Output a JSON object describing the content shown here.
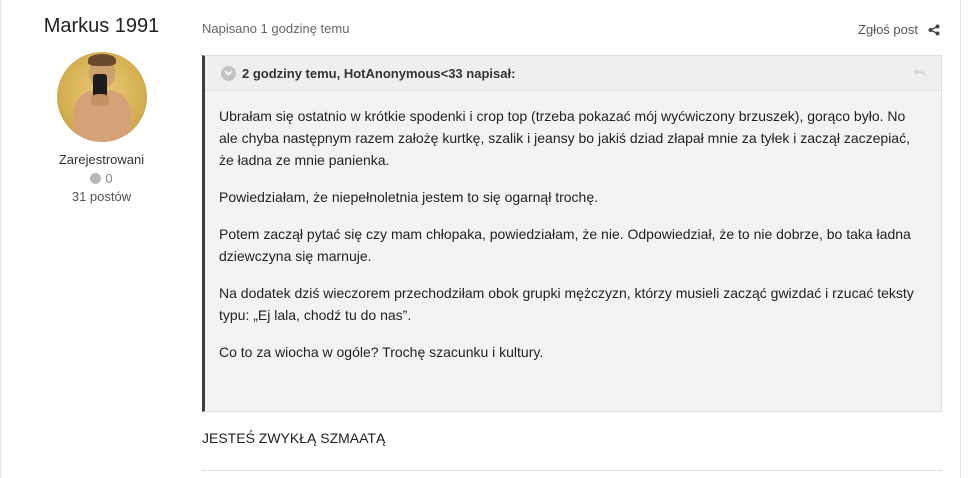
{
  "author": {
    "name": "Markus 1991",
    "group": "Zarejestrowani",
    "reputation": "0",
    "posts": "31 postów"
  },
  "post": {
    "meta": "Napisano 1 godzinę temu",
    "report_label": "Zgłoś post",
    "quote": {
      "citation": "2 godziny temu, HotAnonymous<33 napisał:",
      "paragraphs": [
        "Ubrałam się ostatnio w krótkie spodenki i crop top (trzeba pokazać mój wyćwiczony brzuszek), gorąco było. No ale chyba następnym razem założę kurtkę, szalik i jeansy bo jakiś dziad złapał mnie za tyłek i zaczął zaczepiać, że ładna ze mnie panienka.",
        "Powiedziałam, że niepełnoletnia jestem to się ogarnął trochę.",
        "Potem zaczął pytać się czy mam chłopaka, powiedziałam, że nie. Odpowiedział, że to nie dobrze, bo taka ładna dziewczyna się marnuje.",
        "Na dodatek dziś wieczorem przechodziłam obok grupki mężczyzn, którzy musieli zacząć gwizdać i rzucać teksty typu: „Ej lala, chodź tu do nas”.",
        "Co to za wiocha w ogóle? Trochę szacunku i kultury."
      ]
    },
    "reply": "JESTEŚ ZWYKŁĄ SZMAATĄ"
  },
  "icons": {
    "share": "share-icon",
    "toggle": "chevron-down-icon",
    "quote_link": "reply-arrow-icon",
    "reputation": "reputation-dot-icon"
  },
  "colors": {
    "quote_border": "#3d3d3d",
    "quote_bg": "#f3f3f3"
  }
}
